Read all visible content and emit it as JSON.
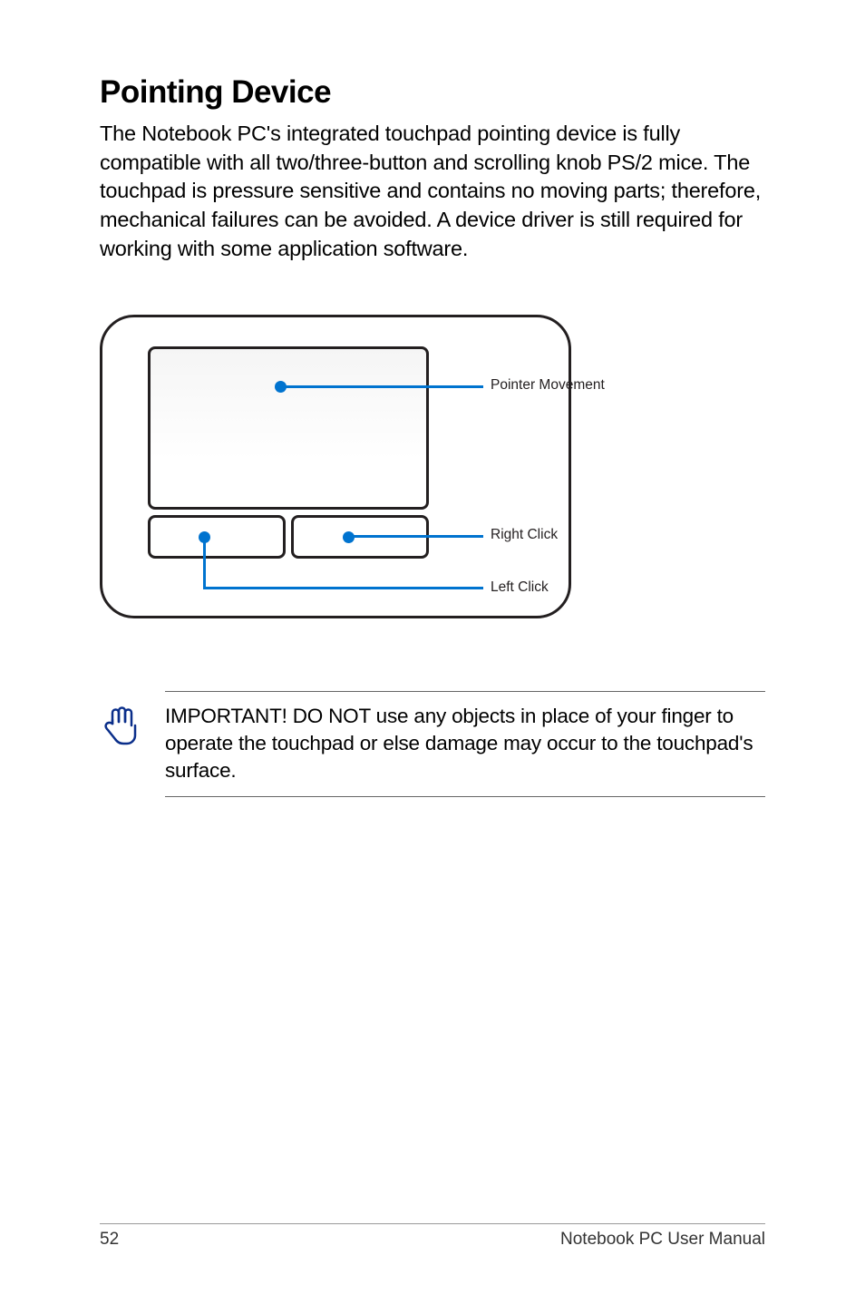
{
  "heading": "Pointing Device",
  "intro": "The Notebook PC's integrated touchpad pointing device is fully compatible with all two/three-button and scrolling knob PS/2 mice. The touchpad is pressure sensitive and contains no moving parts; therefore, mechanical failures can be avoided. A device driver is still required for working with some application software.",
  "diagram": {
    "pointer_label": "Pointer Movement",
    "right_label": "Right Click",
    "left_label": "Left Click"
  },
  "note": "IMPORTANT! DO NOT use any objects in place of your finger to operate the touchpad or else damage may occur to the touchpad's surface.",
  "footer": {
    "page": "52",
    "title": "Notebook PC User Manual"
  }
}
